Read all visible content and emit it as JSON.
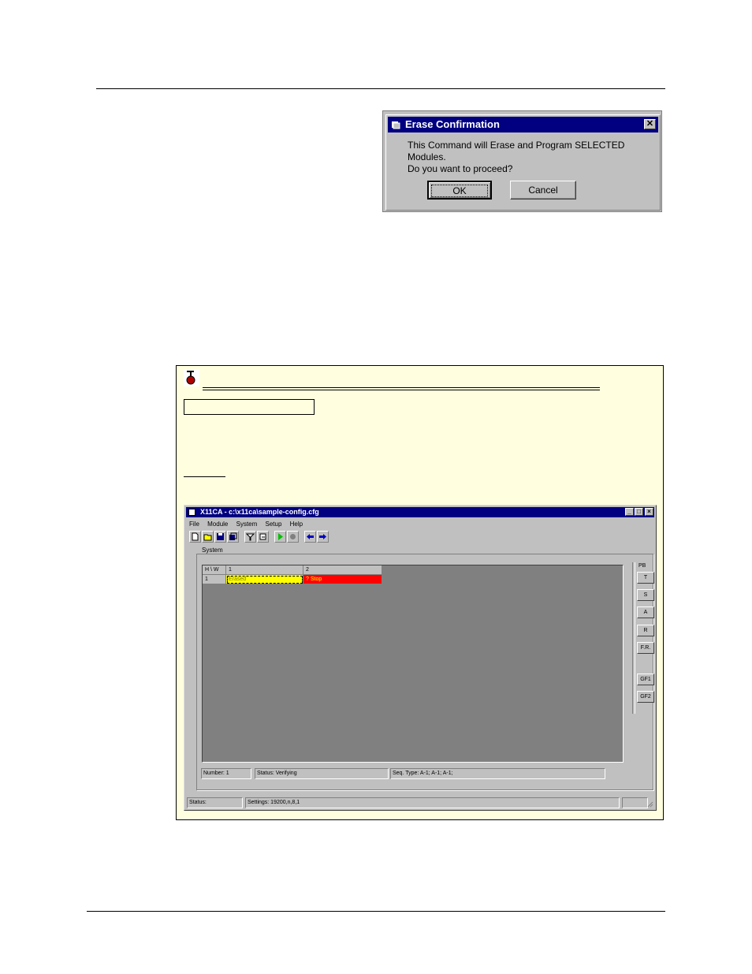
{
  "dialog": {
    "title": "Erase Confirmation",
    "message_line1": "This Command will Erase and Program  SELECTED Modules.",
    "message_line2": "Do you want to proceed?",
    "ok_label": "OK",
    "cancel_label": "Cancel",
    "close_label": "✕"
  },
  "app": {
    "title": "X11CA - c:\\x11ca\\sample-config.cfg",
    "window_controls": [
      "_",
      "□",
      "×"
    ],
    "menu": [
      "File",
      "Module",
      "System",
      "Setup",
      "Help"
    ],
    "group_label": "System",
    "grid": {
      "corner": "H \\ W",
      "col1": "1",
      "col2": "2",
      "row_label": "1",
      "cell1": "Erased",
      "cell2": "? Stop"
    },
    "pb_label": "PB",
    "pb_buttons": [
      "T",
      "S",
      "A",
      "R",
      "F.R.",
      "GF1",
      "GF2"
    ],
    "info_bar": {
      "number": "Number: 1",
      "status": "Status: Verifying",
      "seq": "Seq. Type: A-1; A-1; A-1;"
    },
    "status_bar": {
      "status": "Status:",
      "settings": "Settings: 19200,n,8,1"
    },
    "colors": {
      "erased": "#ffff00",
      "stop": "#ff0000",
      "grid_bg": "#808080",
      "title": "#000080"
    }
  }
}
